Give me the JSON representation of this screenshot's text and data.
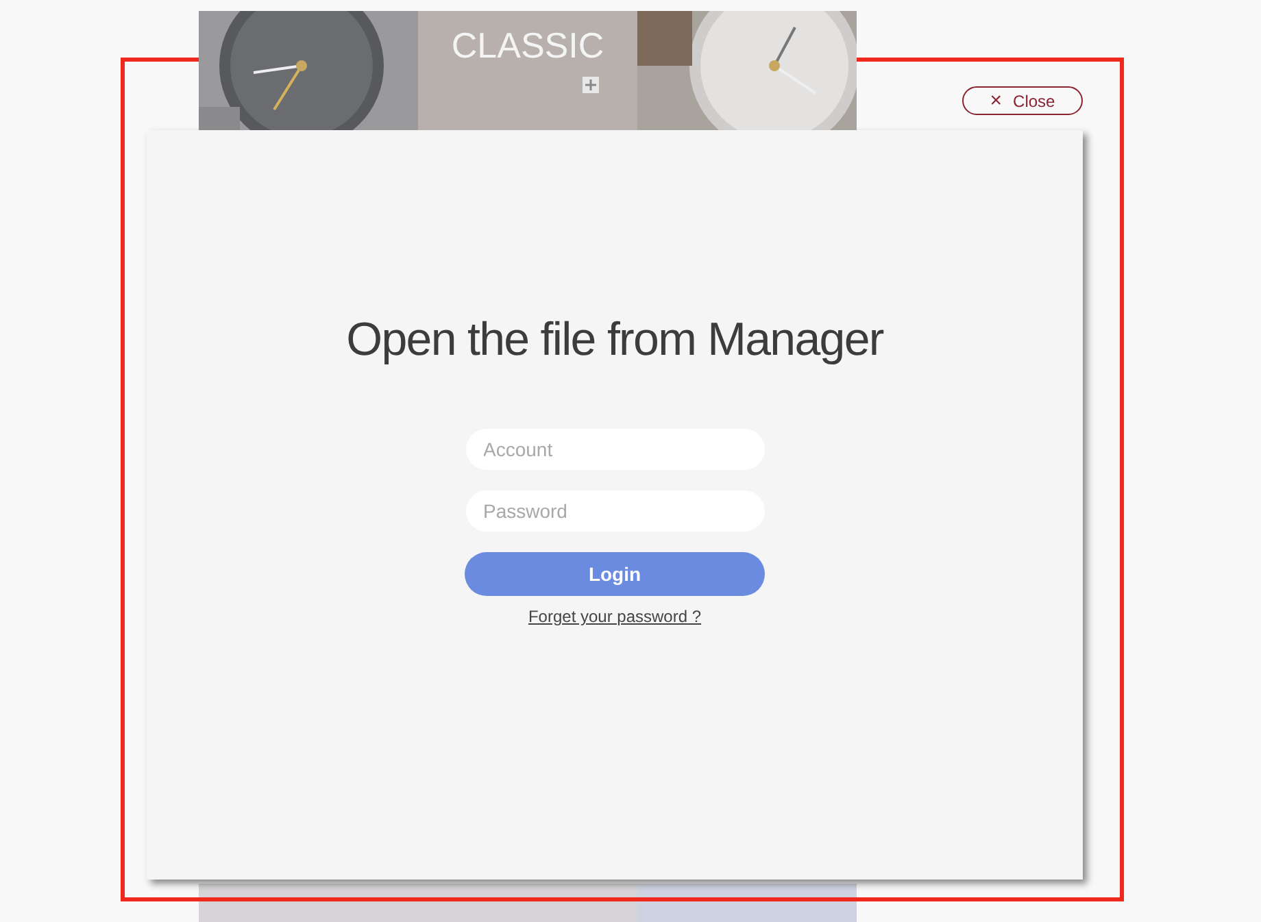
{
  "background_page": {
    "banner_tiles": [
      {
        "kind": "picture"
      },
      {
        "kind": "text",
        "label": "CLASSIC"
      },
      {
        "kind": "picture"
      }
    ]
  },
  "dialog": {
    "close_button": {
      "icon": "×",
      "label": "Close"
    },
    "title": "Open the file from Manager",
    "account_field": {
      "placeholder": "Account"
    },
    "password_field": {
      "placeholder": "Password"
    },
    "login_button": "Login",
    "forgot_link": "Forget your password ?"
  }
}
